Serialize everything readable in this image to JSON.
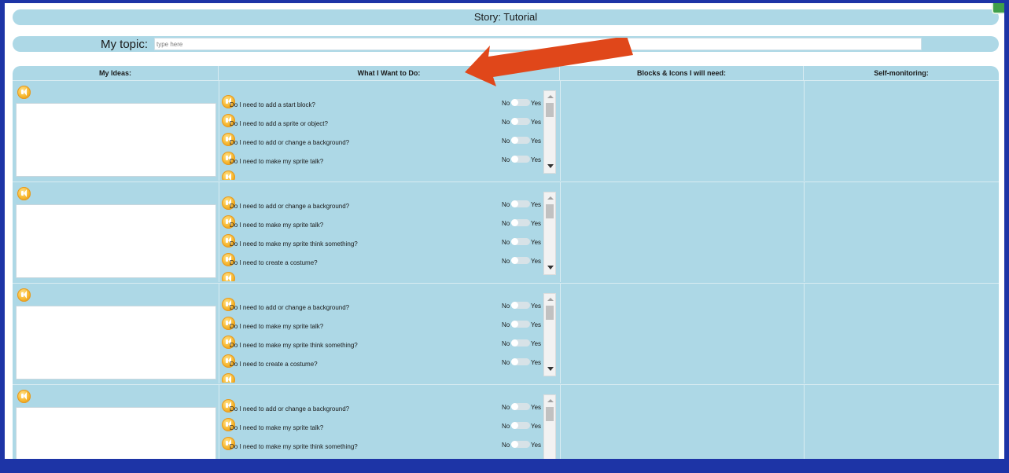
{
  "header": {
    "title": "Story: Tutorial"
  },
  "topic": {
    "label": "My topic:",
    "placeholder": "type here",
    "value": ""
  },
  "columns": [
    {
      "label": "My Ideas:"
    },
    {
      "label": "What I Want to Do:"
    },
    {
      "label": "Blocks & Icons I will need:"
    },
    {
      "label": "Self-monitoring:"
    }
  ],
  "toggle_labels": {
    "no": "No",
    "yes": "Yes"
  },
  "rows": [
    {
      "questions": [
        "Do I need to add a start block?",
        "Do I need to add a sprite or object?",
        "Do I need to add or change a background?",
        "Do I need to make my sprite talk?"
      ]
    },
    {
      "questions": [
        "Do I need to add or change a background?",
        "Do I need to make my sprite talk?",
        "Do I need to make my sprite think something?",
        "Do I need to create a costume?"
      ]
    },
    {
      "questions": [
        "Do I need to add or change a background?",
        "Do I need to make my sprite talk?",
        "Do I need to make my sprite think something?",
        "Do I need to create a costume?"
      ]
    },
    {
      "questions": [
        "Do I need to add or change a background?",
        "Do I need to make my sprite talk?",
        "Do I need to make my sprite think something?"
      ]
    }
  ],
  "icons": {
    "audio": "speaker-icon",
    "annotation": "arrow-icon",
    "app_badge": "app-badge-icon"
  },
  "colors": {
    "frame": "#1d34a6",
    "panel": "#add8e6",
    "arrow": "#e0471a",
    "speaker": "#f7b52b"
  }
}
